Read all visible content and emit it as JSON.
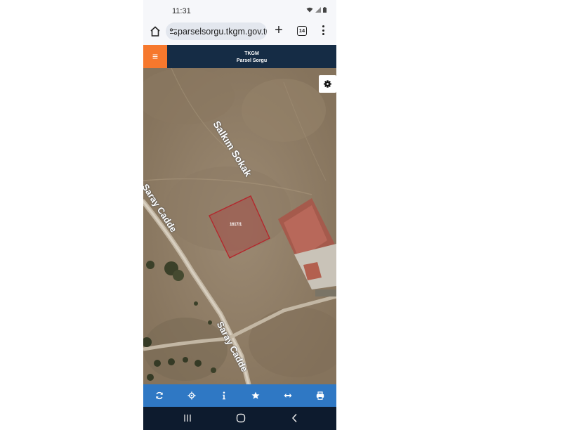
{
  "status_bar": {
    "time": "11:31"
  },
  "browser": {
    "url": "parselsorgu.tkgm.gov.tr",
    "tab_count": "14"
  },
  "app": {
    "title_line1": "TKGM",
    "title_line2": "Parsel Sorgu",
    "menu_glyph": "≡"
  },
  "map": {
    "parcel_label": "1617/1",
    "streets": [
      "Salkım Sokak",
      "Saray Cadde",
      "Saray Cadde"
    ]
  },
  "toolbar": {
    "icons": [
      "refresh-icon",
      "locate-icon",
      "info-icon",
      "star-icon",
      "measure-icon",
      "print-icon"
    ]
  },
  "colors": {
    "header": "#152c45",
    "menu_button": "#f6782d",
    "toolbar": "#2f78c4",
    "parcel_outline": "#b3282d"
  }
}
